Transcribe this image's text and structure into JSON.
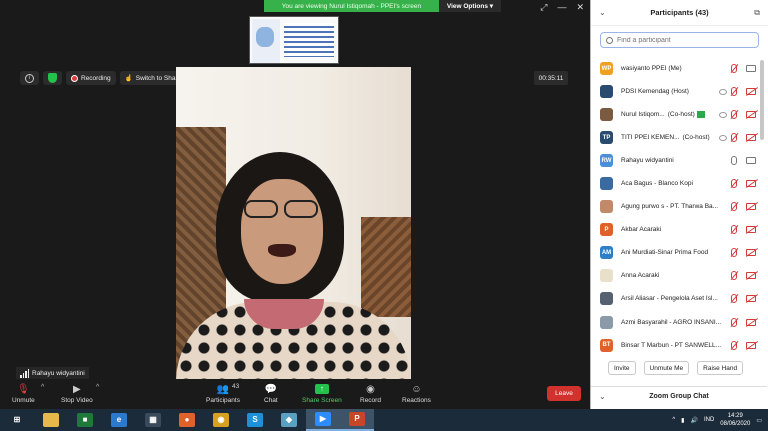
{
  "share_banner": {
    "text": "You are viewing Nurul Istiqomah - PPEI's screen",
    "view_options": "View Options ▾"
  },
  "top": {
    "recording": "Recording",
    "switch": "Switch to Shared Content",
    "timer": "00:35:11"
  },
  "video": {
    "name": "Rahayu widyantini"
  },
  "toolbar": {
    "unmute": "Unmute",
    "stop_video": "Stop Video",
    "participants": "Participants",
    "participants_count": "43",
    "chat": "Chat",
    "share_screen": "Share Screen",
    "record": "Record",
    "reactions": "Reactions",
    "leave": "Leave"
  },
  "panel": {
    "title": "Participants (43)",
    "search_placeholder": "Find a participant",
    "invite": "Invite",
    "unmute_me": "Unmute Me",
    "raise_hand": "Raise Hand",
    "zoom_group_chat": "Zoom Group Chat",
    "participants": [
      {
        "initials": "WP",
        "color": "#f0a020",
        "name": "wasiyanto PPEI (Me)",
        "role": "",
        "mic": "off",
        "cam": "on",
        "share": false
      },
      {
        "initials": "",
        "color": "#2a4b6e",
        "name": "PDSI Kemendag (Host)",
        "role": "",
        "mic": "off",
        "cam": "off",
        "share": true
      },
      {
        "initials": "",
        "color": "#7a5a40",
        "name": "Nurul Istiqom...",
        "role": "(Co-host)",
        "mic": "off",
        "cam": "off",
        "share": true,
        "badge": true
      },
      {
        "initials": "TP",
        "color": "#2a4b6e",
        "name": "TITI PPEI KEMEN...",
        "role": "(Co-host)",
        "mic": "off",
        "cam": "off",
        "share": true
      },
      {
        "initials": "RW",
        "color": "#4a8fd8",
        "name": "Rahayu widyantini",
        "role": "",
        "mic": "on",
        "cam": "on",
        "share": false
      },
      {
        "initials": "",
        "color": "#3a6aa0",
        "name": "Aca Bagus - Blanco Kopi",
        "role": "",
        "mic": "off",
        "cam": "off",
        "share": false
      },
      {
        "initials": "",
        "color": "#c08a6a",
        "name": "Agung purwo s - PT. Tharwa Ba...",
        "role": "",
        "mic": "off",
        "cam": "off",
        "share": false
      },
      {
        "initials": "P",
        "color": "#e0622a",
        "name": "Akbar Acaraki",
        "role": "",
        "mic": "off",
        "cam": "off",
        "share": false
      },
      {
        "initials": "AM",
        "color": "#2f7fc8",
        "name": "Ani Murdiati-Sinar Prima Food",
        "role": "",
        "mic": "off",
        "cam": "off",
        "share": false
      },
      {
        "initials": "",
        "color": "#e8e0c8",
        "name": "Anna Acaraki",
        "role": "",
        "mic": "off",
        "cam": "off",
        "share": false
      },
      {
        "initials": "",
        "color": "#556070",
        "name": "Arsil Aliasar - Pengelola Aset Isl...",
        "role": "",
        "mic": "off",
        "cam": "off",
        "share": false
      },
      {
        "initials": "",
        "color": "#8a9aa8",
        "name": "Azmi Basyarahil - AGRO INSANI...",
        "role": "",
        "mic": "off",
        "cam": "off",
        "share": false
      },
      {
        "initials": "BT",
        "color": "#e0622a",
        "name": "Binsar T Marbun - PT SANWELL...",
        "role": "",
        "mic": "off",
        "cam": "off",
        "share": false
      }
    ]
  },
  "taskbar": {
    "items": [
      {
        "name": "windows-start",
        "color": "#1c2b3a",
        "glyph": "⊞"
      },
      {
        "name": "file-explorer",
        "color": "#e6b84a",
        "glyph": ""
      },
      {
        "name": "store",
        "color": "#1e7a3a",
        "glyph": "■"
      },
      {
        "name": "internet-explorer",
        "color": "#2a7ad0",
        "glyph": "e"
      },
      {
        "name": "calculator",
        "color": "#3a4a5a",
        "glyph": "▦"
      },
      {
        "name": "firefox",
        "color": "#e0622a",
        "glyph": "●"
      },
      {
        "name": "chrome",
        "color": "#d8a020",
        "glyph": "◉"
      },
      {
        "name": "skype",
        "color": "#1e90d8",
        "glyph": "S"
      },
      {
        "name": "app-generic",
        "color": "#5aa0c0",
        "glyph": "◆"
      },
      {
        "name": "zoom",
        "color": "#2d8cff",
        "glyph": "▶"
      },
      {
        "name": "powerpoint",
        "color": "#c8452a",
        "glyph": "P"
      }
    ],
    "lang": "IND",
    "time": "14:29",
    "date": "08/06/2020"
  }
}
